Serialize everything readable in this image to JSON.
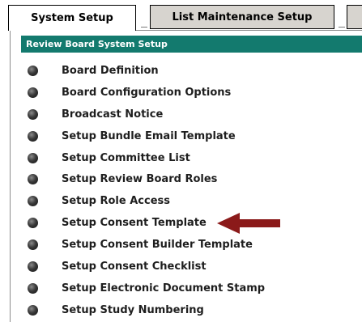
{
  "tabs": [
    {
      "label": "System Setup",
      "active": true
    },
    {
      "label": "List Maintenance Setup",
      "active": false
    },
    {
      "label": "",
      "active": false
    }
  ],
  "section": {
    "title": "Review Board System Setup"
  },
  "menu": {
    "items": [
      {
        "label": "Board Definition"
      },
      {
        "label": "Board Configuration Options"
      },
      {
        "label": "Broadcast Notice"
      },
      {
        "label": "Setup Bundle Email Template"
      },
      {
        "label": "Setup Committee List"
      },
      {
        "label": "Setup Review Board Roles"
      },
      {
        "label": "Setup Role Access"
      },
      {
        "label": "Setup Consent Template"
      },
      {
        "label": "Setup Consent Builder Template"
      },
      {
        "label": "Setup Consent Checklist"
      },
      {
        "label": "Setup Electronic Document Stamp"
      },
      {
        "label": "Setup Study Numbering"
      }
    ]
  },
  "annotation": {
    "icon": "arrow-left-icon",
    "color": "#8b1a1a",
    "points_to": "Setup Consent Template"
  },
  "colors": {
    "header_bg": "#137a6e",
    "inactive_tab_bg": "#d7d4cf"
  }
}
